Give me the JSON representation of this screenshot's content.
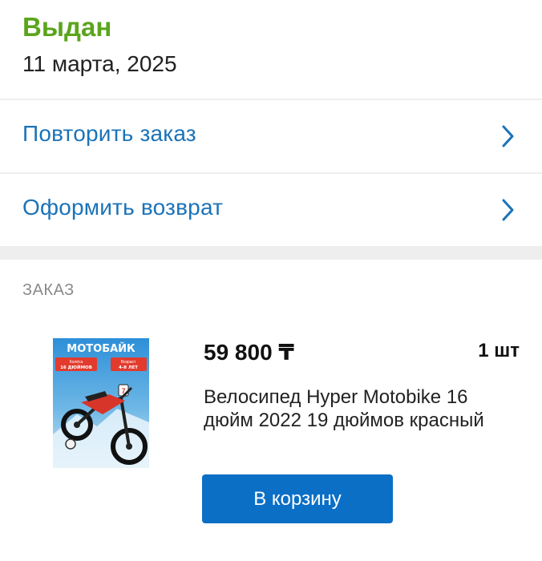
{
  "order_status": {
    "title": "Выдан",
    "date": "11 марта, 2025"
  },
  "actions": [
    {
      "label": "Повторить заказ",
      "icon": "chevron-right-icon"
    },
    {
      "label": "Оформить возврат",
      "icon": "chevron-right-icon"
    }
  ],
  "order_section": {
    "label": "ЗАКАЗ",
    "item": {
      "price": "59 800 ₸",
      "quantity": "1 шт",
      "name": "Велосипед Hyper Motobike 16 дюйм 2022 19 дюймов красный",
      "button_label": "В корзину",
      "image": {
        "headline": "МОТОБАЙК",
        "left_badge_line1": "Колёса",
        "left_badge_line2": "16 ДЮЙМОВ",
        "right_badge_line1": "Возраст",
        "right_badge_line2": "4-8 ЛЕТ"
      }
    }
  },
  "colors": {
    "status_green": "#5aa51c",
    "link_blue": "#1b73b8",
    "button_blue": "#0b6fc6",
    "divider_gray": "#eeeeee"
  }
}
